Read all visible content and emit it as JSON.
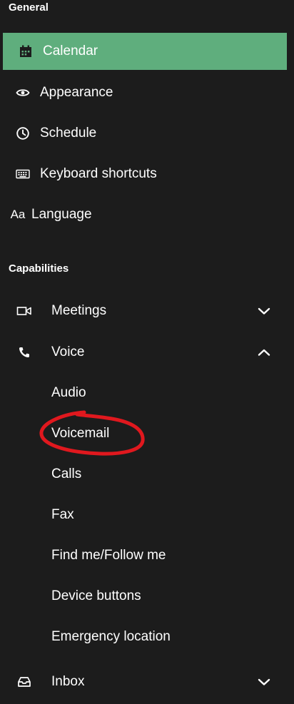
{
  "sections": {
    "general": "General",
    "capabilities": "Capabilities"
  },
  "general_items": [
    {
      "label": "Calendar",
      "icon": "calendar-icon",
      "active": true
    },
    {
      "label": "Appearance",
      "icon": "eye-icon",
      "active": false
    },
    {
      "label": "Schedule",
      "icon": "clock-icon",
      "active": false
    },
    {
      "label": "Keyboard shortcuts",
      "icon": "keyboard-icon",
      "active": false
    },
    {
      "label": "Language",
      "icon": "language-icon",
      "icon_text": "Aa",
      "active": false
    }
  ],
  "capabilities": {
    "meetings": {
      "label": "Meetings",
      "icon": "video-camera-icon",
      "expanded": false
    },
    "voice": {
      "label": "Voice",
      "icon": "phone-icon",
      "expanded": true,
      "subitems": [
        "Audio",
        "Voicemail",
        "Calls",
        "Fax",
        "Find me/Follow me",
        "Device buttons",
        "Emergency location"
      ]
    },
    "inbox": {
      "label": "Inbox",
      "icon": "inbox-icon",
      "expanded": false
    }
  },
  "colors": {
    "background": "#1c1c1c",
    "active": "#5fae7d",
    "annotation": "#e0181e"
  },
  "annotation": {
    "target": "Voicemail"
  }
}
